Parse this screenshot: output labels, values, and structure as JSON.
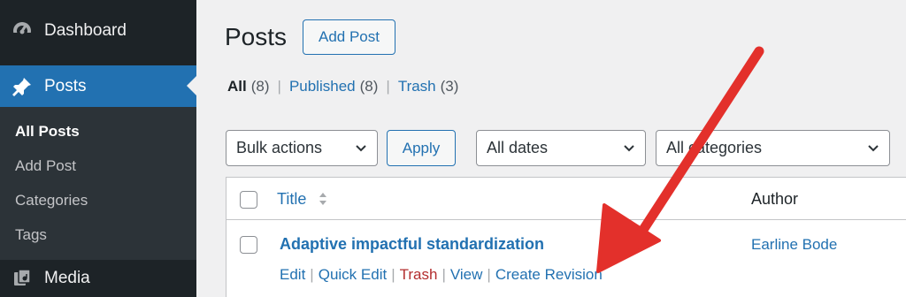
{
  "sidebar": {
    "dashboard_label": "Dashboard",
    "posts_label": "Posts",
    "submenu": [
      "All Posts",
      "Add Post",
      "Categories",
      "Tags"
    ],
    "media_label": "Media"
  },
  "header": {
    "title": "Posts",
    "add_post_label": "Add Post"
  },
  "filters": {
    "all_label": "All",
    "all_count": "(8)",
    "published_label": "Published",
    "published_count": "(8)",
    "trash_label": "Trash",
    "trash_count": "(3)"
  },
  "toolbar": {
    "bulk_actions": "Bulk actions",
    "apply_label": "Apply",
    "dates": "All dates",
    "categories": "All categories"
  },
  "table": {
    "columns": [
      "Title",
      "Author"
    ],
    "rows": [
      {
        "title": "Adaptive impactful standardization",
        "author": "Earline Bode",
        "actions": [
          "Edit",
          "Quick Edit",
          "Trash",
          "View",
          "Create Revision"
        ]
      }
    ]
  },
  "colors": {
    "sidebar_bg": "#1d2327",
    "accent": "#2271b1",
    "arrow": "#e3302b"
  }
}
